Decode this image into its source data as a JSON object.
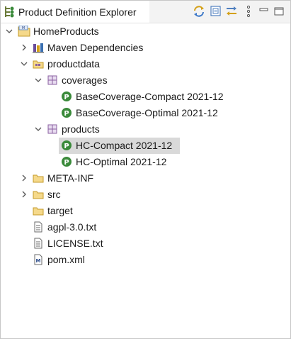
{
  "view": {
    "title": "Product Definition Explorer",
    "toolbar": [
      "sync-icon",
      "collapse-all-icon",
      "link-editor-icon",
      "view-menu-icon",
      "minimize-icon",
      "maximize-icon"
    ]
  },
  "tree": {
    "root": {
      "label": "HomeProducts",
      "expanded": true,
      "icon": "project-icon"
    },
    "maven": {
      "label": "Maven Dependencies",
      "expanded": false,
      "icon": "library-icon"
    },
    "productdata": {
      "label": "productdata",
      "expanded": true,
      "icon": "source-folder-icon"
    },
    "coverages": {
      "label": "coverages",
      "expanded": true,
      "icon": "package-icon"
    },
    "coverage_items": [
      {
        "label": "BaseCoverage-Compact 2021-12",
        "icon": "product-cmpt-icon"
      },
      {
        "label": "BaseCoverage-Optimal 2021-12",
        "icon": "product-cmpt-icon"
      }
    ],
    "products": {
      "label": "products",
      "expanded": true,
      "icon": "package-icon"
    },
    "product_items": [
      {
        "label": "HC-Compact 2021-12",
        "icon": "product-cmpt-icon",
        "selected": true
      },
      {
        "label": "HC-Optimal 2021-12",
        "icon": "product-cmpt-icon",
        "selected": false
      }
    ],
    "meta_inf": {
      "label": "META-INF",
      "expanded": false,
      "icon": "folder-icon"
    },
    "src": {
      "label": "src",
      "expanded": false,
      "icon": "folder-icon"
    },
    "target": {
      "label": "target",
      "icon": "folder-icon"
    },
    "files": [
      {
        "label": "agpl-3.0.txt",
        "icon": "text-file-icon"
      },
      {
        "label": "LICENSE.txt",
        "icon": "text-file-icon"
      },
      {
        "label": "pom.xml",
        "icon": "maven-pom-icon"
      }
    ]
  },
  "colors": {
    "selection": "#d9d9d9",
    "product_icon": "#3a8a3a",
    "folder": "#e8b84a",
    "package": "#8a5fa0"
  }
}
